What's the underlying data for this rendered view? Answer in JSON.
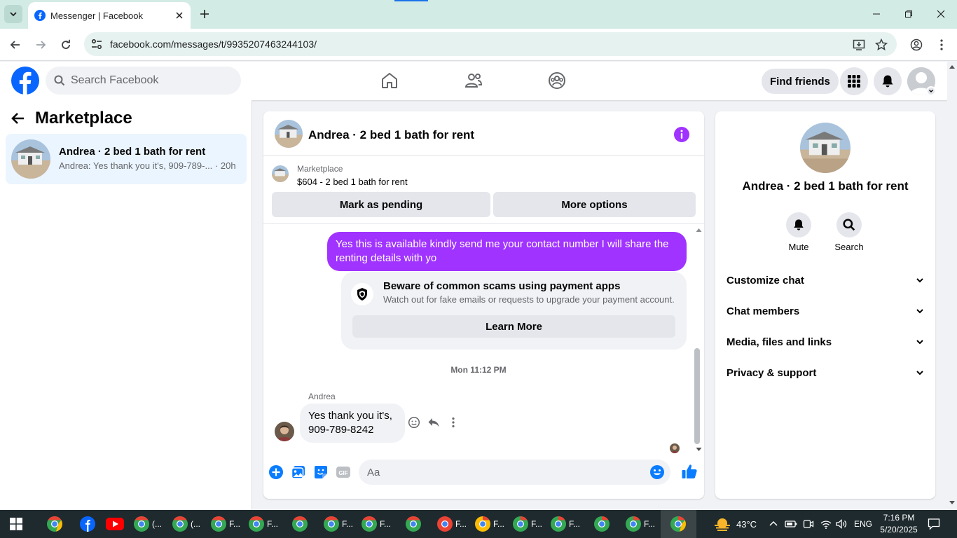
{
  "browser": {
    "tab_title": "Messenger | Facebook",
    "url": "facebook.com/messages/t/9935207463244103/"
  },
  "fb_header": {
    "search_placeholder": "Search Facebook",
    "find_friends_label": "Find friends"
  },
  "sidebar": {
    "title": "Marketplace",
    "conversations": [
      {
        "name": "Andrea · 2 bed 1 bath for rent",
        "preview": "Andrea: Yes thank you it's, 909-789-...",
        "time": "· 20h"
      }
    ]
  },
  "chat": {
    "title": "Andrea · 2 bed 1 bath for rent",
    "marketplace_label": "Marketplace",
    "listing": "$604 - 2 bed 1 bath for rent",
    "mark_pending_label": "Mark as pending",
    "more_options_label": "More options",
    "outgoing_message": "Yes this is available kindly send me your contact number I will share the renting details with yo",
    "scam_title": "Beware of common scams using payment apps",
    "scam_text": "Watch out for fake emails or requests to upgrade your payment account.",
    "learn_more_label": "Learn More",
    "timestamp": "Mon 11:12 PM",
    "sender_name": "Andrea",
    "incoming_message": "Yes thank you it's, 909-789-8242",
    "composer_placeholder": "Aa",
    "gif_label": "GIF"
  },
  "info_panel": {
    "title": "Andrea · 2 bed 1 bath for rent",
    "mute_label": "Mute",
    "search_label": "Search",
    "sections": [
      "Customize chat",
      "Chat members",
      "Media, files and links",
      "Privacy & support"
    ]
  },
  "taskbar": {
    "items": [
      "(...",
      "(...",
      "F...",
      "F...",
      "F...",
      "F...",
      "F...",
      "F...",
      "F...",
      "F...",
      "F..."
    ],
    "weather": "43°C",
    "language": "ENG",
    "time": "7:16 PM",
    "date": "5/20/2025"
  },
  "colors": {
    "accent_purple": "#a033ff",
    "fb_blue": "#0866ff",
    "messenger_blue": "#0a7cff"
  }
}
